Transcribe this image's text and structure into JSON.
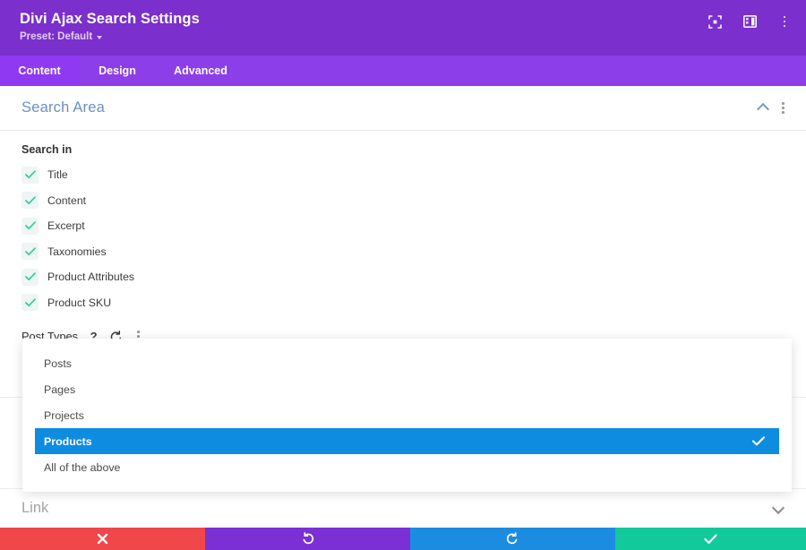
{
  "header": {
    "title": "Divi Ajax Search Settings",
    "preset_label": "Preset: Default",
    "icons": [
      {
        "name": "fullscreen-icon",
        "label": "fullscreen"
      },
      {
        "name": "layout-view-icon",
        "label": "layout view"
      },
      {
        "name": "more-options-icon",
        "label": "more options"
      }
    ],
    "colors": {
      "bar": "#7b2fcc",
      "tabs": "#8c3ee8",
      "tab_active": "#9039f2"
    }
  },
  "tabs": [
    {
      "label": "Content",
      "active": true
    },
    {
      "label": "Design",
      "active": false
    },
    {
      "label": "Advanced",
      "active": false
    }
  ],
  "section": {
    "title": "Search Area",
    "collapse_state": "expanded"
  },
  "search_in": {
    "label": "Search in",
    "options": [
      {
        "label": "Title",
        "checked": true
      },
      {
        "label": "Content",
        "checked": true
      },
      {
        "label": "Excerpt",
        "checked": true
      },
      {
        "label": "Taxonomies",
        "checked": true
      },
      {
        "label": "Product Attributes",
        "checked": true
      },
      {
        "label": "Product SKU",
        "checked": true
      }
    ]
  },
  "post_types": {
    "label": "Post Types",
    "help_glyph": "?",
    "reset_glyph": "↺",
    "dropdown_open": true,
    "selected": "Products",
    "options": [
      {
        "label": "Posts",
        "selected": false
      },
      {
        "label": "Pages",
        "selected": false
      },
      {
        "label": "Projects",
        "selected": false
      },
      {
        "label": "Products",
        "selected": true
      },
      {
        "label": "All of the above",
        "selected": false
      }
    ],
    "selected_color": "#0e8ce0"
  },
  "link_section": {
    "title": "Link",
    "collapse_state": "collapsed"
  },
  "footer": {
    "buttons": [
      {
        "name": "cancel",
        "glyph": "✖",
        "color": "#f0474b"
      },
      {
        "name": "undo",
        "glyph": "↺",
        "color": "#7a30d4"
      },
      {
        "name": "redo",
        "glyph": "↻",
        "color": "#1c8ce0"
      },
      {
        "name": "save",
        "glyph": "✔",
        "color": "#12c99b"
      }
    ]
  }
}
